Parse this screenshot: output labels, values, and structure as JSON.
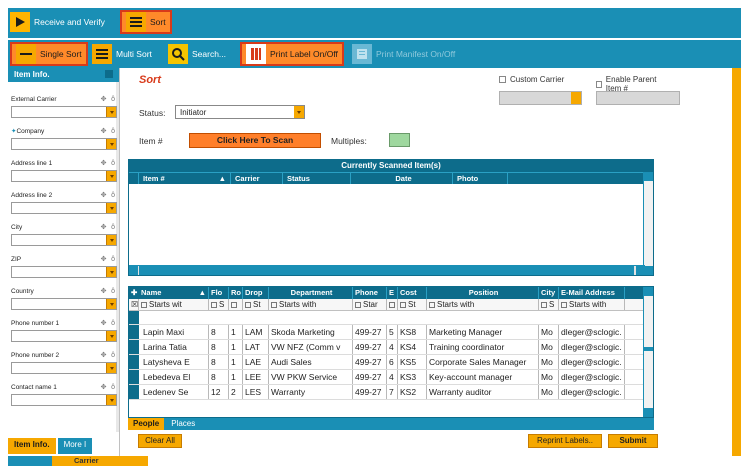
{
  "toolbar1": {
    "receive_verify": "Receive and Verify",
    "sort": "Sort"
  },
  "toolbar2": {
    "single_sort": "Single Sort",
    "multi_sort": "Multi Sort",
    "search": "Search...",
    "print_label": "Print Label On/Off",
    "print_manifest": "Print Manifest On/Off"
  },
  "left_panel": {
    "title": "Item Info.",
    "fields": [
      {
        "label": "External Carrier"
      },
      {
        "label": "Company"
      },
      {
        "label": "Address line 1"
      },
      {
        "label": "Address line 2"
      },
      {
        "label": "City"
      },
      {
        "label": "ZIP"
      },
      {
        "label": "Country"
      },
      {
        "label": "Phone number 1"
      },
      {
        "label": "Phone number 2"
      },
      {
        "label": "Contact name 1"
      }
    ],
    "tabs": [
      "Item Info.",
      "More I"
    ],
    "bottom_tab": "Carrier"
  },
  "main": {
    "title": "Sort",
    "custom_carrier": "Custom Carrier",
    "enable_parent": "Enable Parent Item #",
    "status_label": "Status:",
    "status_value": "Initiator",
    "item_label": "Item #",
    "scan_button": "Click Here To Scan",
    "multiples_label": "Multiples:"
  },
  "scanned_grid": {
    "title": "Currently Scanned Item(s)",
    "columns": [
      "Item #",
      "Carrier",
      "Status",
      "Date",
      "Photo"
    ]
  },
  "people_grid": {
    "columns": [
      "Name",
      "Flo",
      "Ro",
      "Drop",
      "Department",
      "Phone",
      "E",
      "Cost",
      "Position",
      "City",
      "E-Mail Address"
    ],
    "filters": [
      "Starts wit",
      "S",
      "",
      "St",
      "Starts with",
      "Star",
      "",
      "St",
      "Starts with",
      "S",
      "Starts with"
    ],
    "rows": [
      [
        "Lapin Maxi",
        "8",
        "1",
        "LAM",
        "Skoda Marketing",
        "499-27",
        "5",
        "KS8",
        "Marketing Manager",
        "Mo",
        "dleger@sclogic."
      ],
      [
        "Larina Tatia",
        "8",
        "1",
        "LAT",
        "VW NFZ (Comm v",
        "499-27",
        "4",
        "KS4",
        "Training coordinator",
        "Mo",
        "dleger@sclogic."
      ],
      [
        "Latysheva E",
        "8",
        "1",
        "LAE",
        "Audi Sales",
        "499-27",
        "6",
        "KS5",
        "Corporate Sales Manager",
        "Mo",
        "dleger@sclogic."
      ],
      [
        "Lebedeva El",
        "8",
        "1",
        "LEE",
        "VW PKW Service",
        "499-27",
        "4",
        "KS3",
        "Key-account manager",
        "Mo",
        "dleger@sclogic."
      ],
      [
        "Ledenev Se",
        "12",
        "2",
        "LES",
        "Warranty",
        "499-27",
        "7",
        "KS2",
        "Warranty auditor",
        "Mo",
        "dleger@sclogic."
      ]
    ],
    "tabs": [
      "People",
      "Places"
    ]
  },
  "buttons": {
    "clear_all": "Clear All",
    "reprint": "Reprint Labels..",
    "submit": "Submit"
  }
}
